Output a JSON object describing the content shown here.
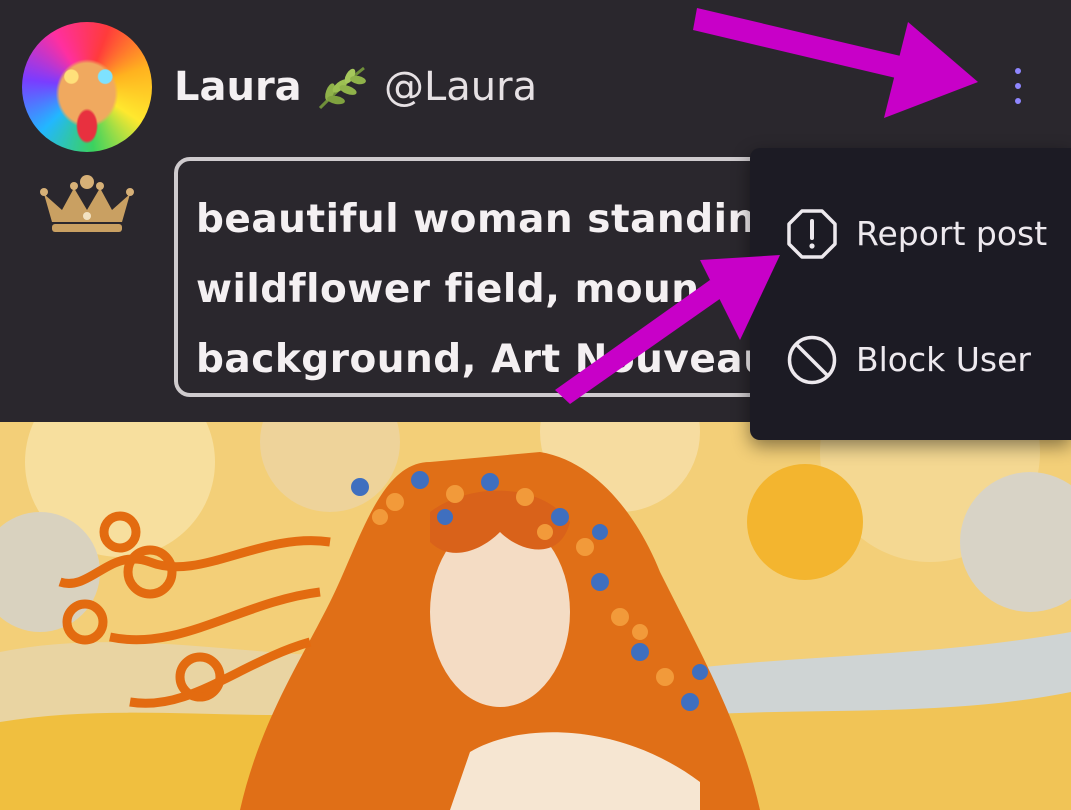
{
  "post": {
    "user_name": "Laura",
    "user_handle": "@Laura",
    "prompt_lines": [
      "beautiful woman standin",
      "wildflower field, moun",
      "background, Art Nouveau"
    ]
  },
  "menu": {
    "report_label": "Report post",
    "block_label": "Block User"
  },
  "icons": {
    "more": "more-vertical-icon",
    "leaf": "leaf-icon",
    "crown": "crown-icon",
    "report": "alert-octagon-icon",
    "block": "block-icon"
  },
  "colors": {
    "background": "#2a272d",
    "menu_background": "#1c1b24",
    "accent_dots": "#8f86ff",
    "annotation_arrow": "#c800c8"
  }
}
